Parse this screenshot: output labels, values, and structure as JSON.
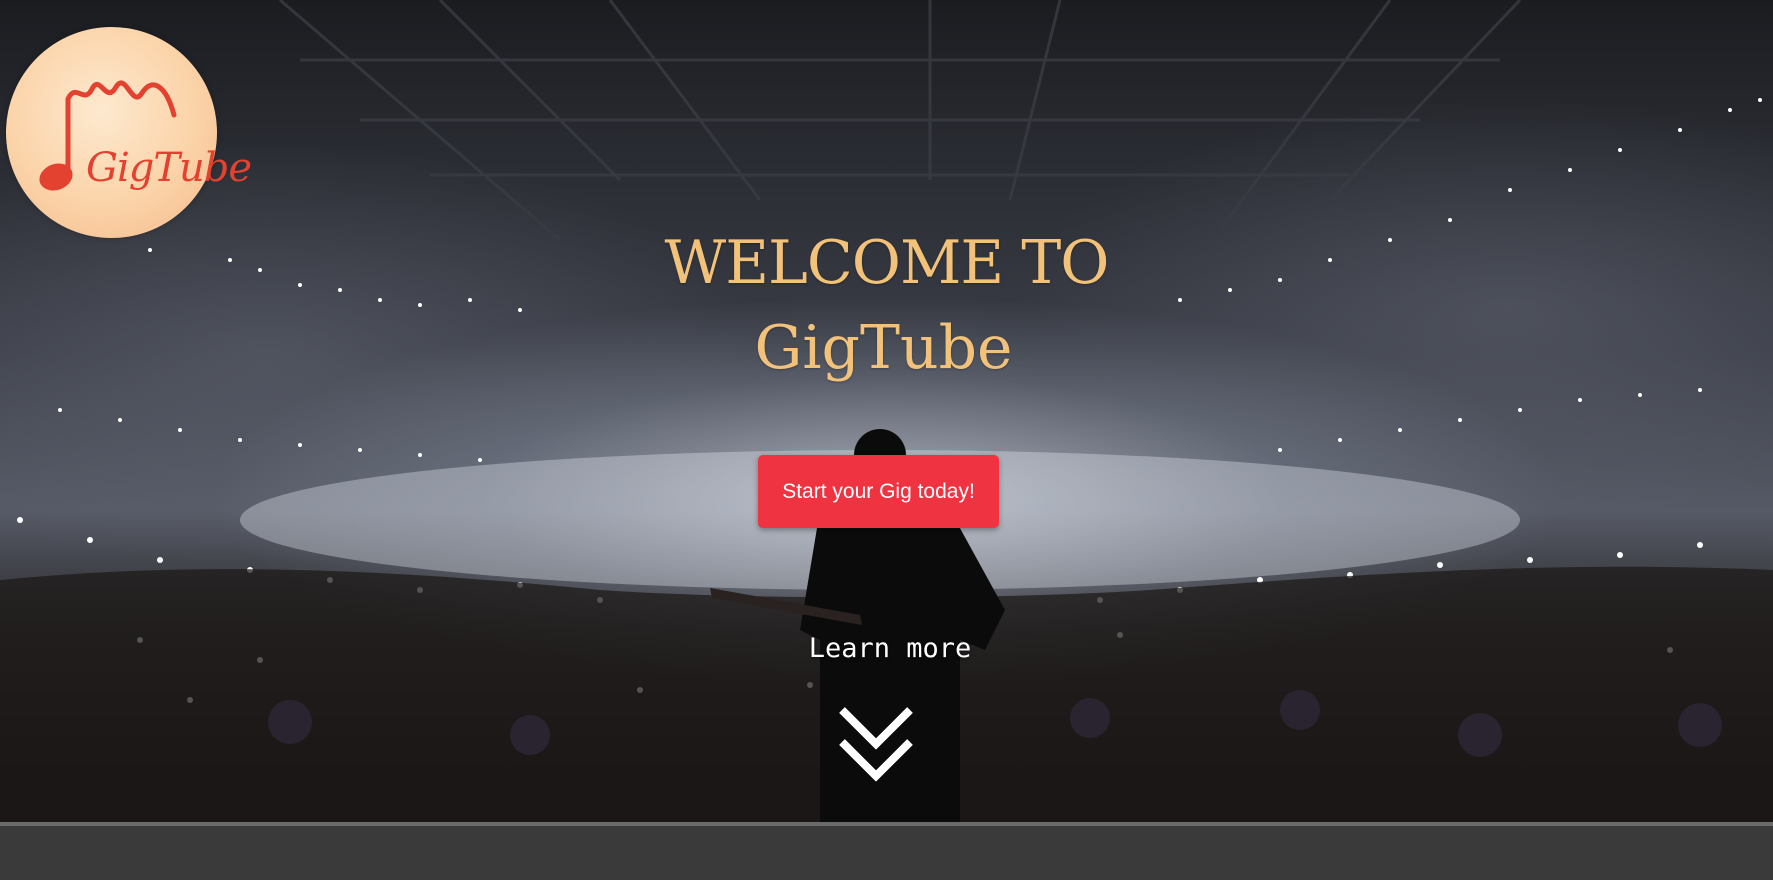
{
  "brand": {
    "logo_text": "GigTube",
    "colors": {
      "headline": "#f2c27a",
      "cta_background": "#ef3340",
      "logo_ink": "#e2422f"
    }
  },
  "hero": {
    "title_line1": "WELCOME TO",
    "title_line2": "GigTube",
    "cta_label": "Start your Gig today!",
    "learn_more_label": "Learn more",
    "scroll_icon": "double-chevron-down-icon"
  }
}
